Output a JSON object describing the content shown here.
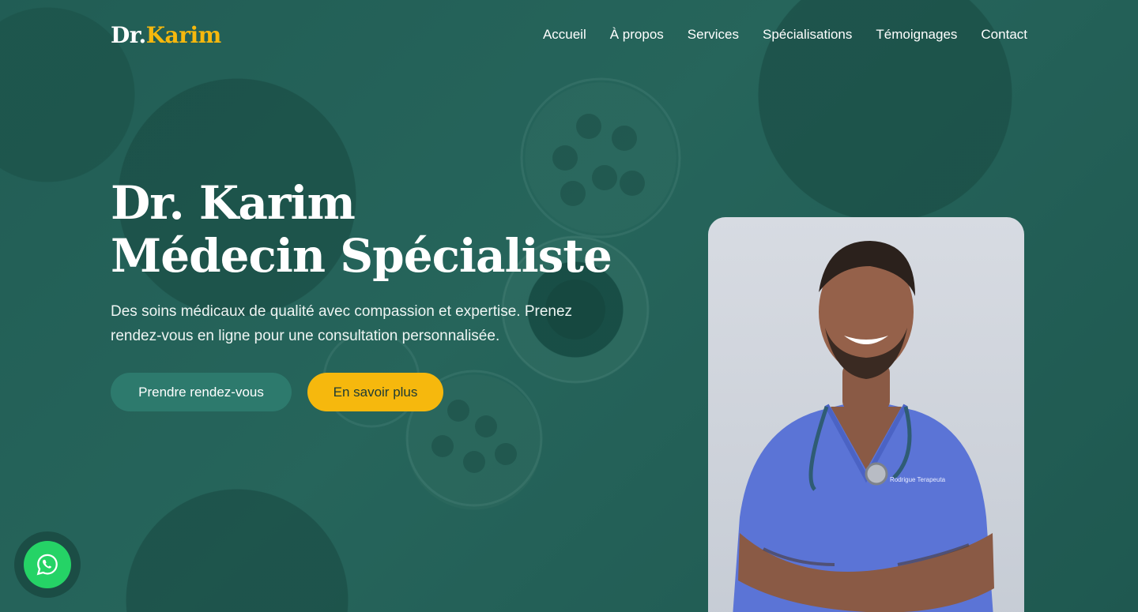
{
  "header": {
    "logo_prefix": "Dr.",
    "logo_name": "Karim",
    "nav": [
      {
        "label": "Accueil"
      },
      {
        "label": "À propos"
      },
      {
        "label": "Services"
      },
      {
        "label": "Spécialisations"
      },
      {
        "label": "Témoignages"
      },
      {
        "label": "Contact"
      }
    ]
  },
  "hero": {
    "title_line1": "Dr. Karim",
    "title_line2": "Médecin Spécialiste",
    "description": "Des soins médicaux de qualité avec compassion et expertise. Prenez rendez-vous en ligne pour une consultation personnalisée.",
    "primary_button": "Prendre rendez-vous",
    "secondary_button": "En savoir plus"
  },
  "photo": {
    "badge_text": "Rodrigue Terapeuta"
  },
  "floating": {
    "whatsapp_icon": "whatsapp-icon"
  },
  "colors": {
    "brand_teal": "#2d7a6d",
    "accent_yellow": "#f6b80d",
    "background_teal": "#1f5a52",
    "whatsapp_green": "#25d366"
  }
}
